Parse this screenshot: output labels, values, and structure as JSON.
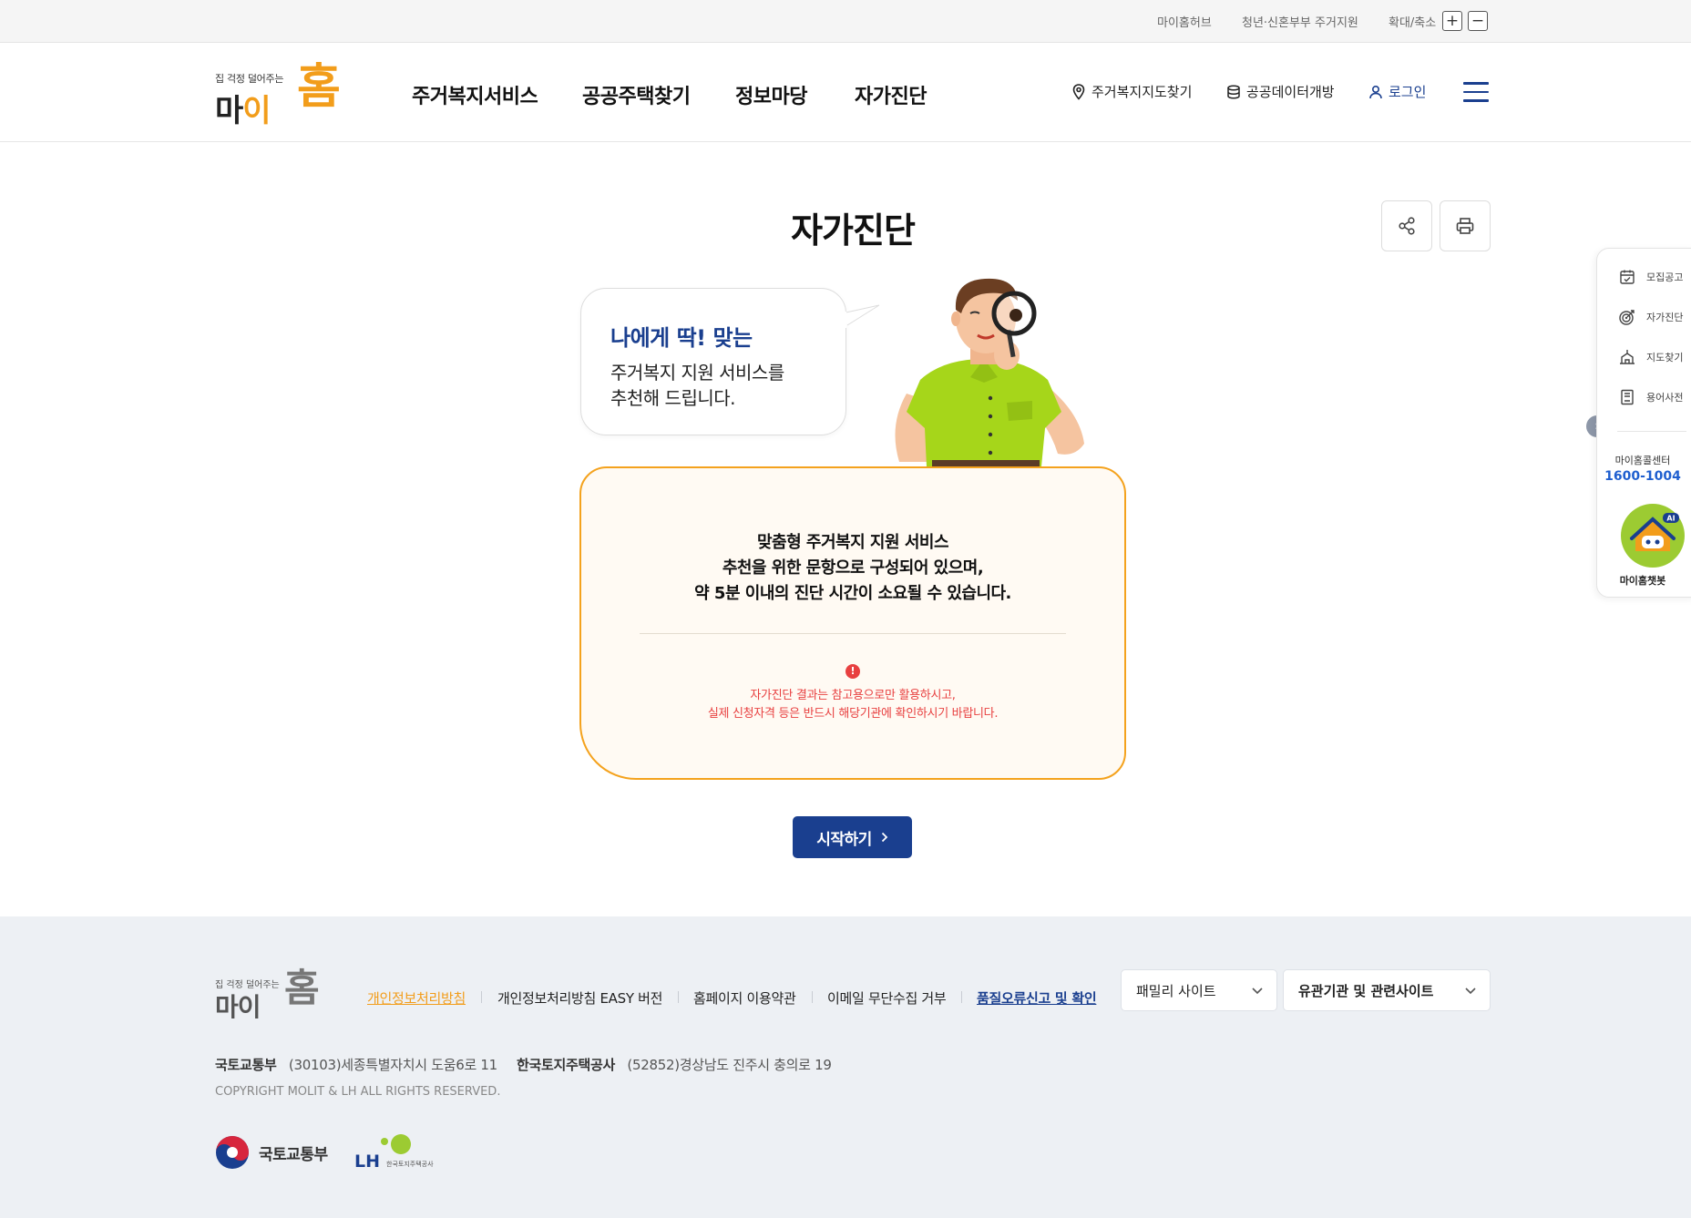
{
  "util": {
    "links": [
      "마이홈허브",
      "청년·신혼부부 주거지원"
    ],
    "zoom_label": "확대/축소",
    "zoom_in": "+",
    "zoom_out": "−"
  },
  "header": {
    "logo_tag": "집 걱정 덜어주는",
    "logo_main_1": "마",
    "logo_main_2": "이",
    "logo_hom": "홈",
    "nav": [
      "주거복지서비스",
      "공공주택찾기",
      "정보마당",
      "자가진단"
    ],
    "map_link": "주거복지지도찾기",
    "data_link": "공공데이터개방",
    "login": "로그인"
  },
  "page": {
    "title": "자가진단"
  },
  "bubble": {
    "title": "나에게 딱! 맞는",
    "line1": "주거복지 지원 서비스를",
    "line2": "추천해 드립니다."
  },
  "card": {
    "line1": "맞춤형 주거복지 지원 서비스",
    "line2": "추천을 위한 문항으로 구성되어 있으며,",
    "line3": "약 5분 이내의 진단 시간이 소요될 수 있습니다.",
    "warn_icon": "!",
    "warn1": "자가진단 결과는 참고용으로만 활용하시고,",
    "warn2": "실제 신청자격 등은 반드시 해당기관에 확인하시기 바랍니다."
  },
  "start_button": "시작하기",
  "quick": {
    "items": [
      "모집공고",
      "자가진단",
      "지도찾기",
      "용어사전"
    ],
    "center_label": "마이홈콜센터",
    "center_number": "1600-1004",
    "chatbot_badge": "AI",
    "chatbot_label": "마이홈챗봇"
  },
  "footer": {
    "logo_tag": "집 걱정 덜어주는",
    "logo_main": "마이",
    "logo_hom": "홈",
    "links": [
      "개인정보처리방침",
      "개인정보처리방침 EASY 버전",
      "홈페이지 이용약관",
      "이메일 무단수집 거부",
      "품질오류신고 및 확인"
    ],
    "family_site": "패밀리 사이트",
    "related_site": "유관기관 및 관련사이트",
    "org1": "국토교통부",
    "addr1": "(30103)세종특별자치시 도움6로 11",
    "org2": "한국토지주택공사",
    "addr2": "(52852)경상남도 진주시 충의로 19",
    "copyright": "COPYRIGHT MOLIT & LH ALL RIGHTS RESERVED.",
    "molit_logo_text": "국토교통부",
    "lh_logo_text": "LH",
    "lh_logo_sub": "한국토지주택공사"
  },
  "colors": {
    "brand_orange": "#f29d1b",
    "brand_navy": "#1a3f8f",
    "warn_red": "#e84040",
    "chatbot_green": "#9ccb32"
  }
}
